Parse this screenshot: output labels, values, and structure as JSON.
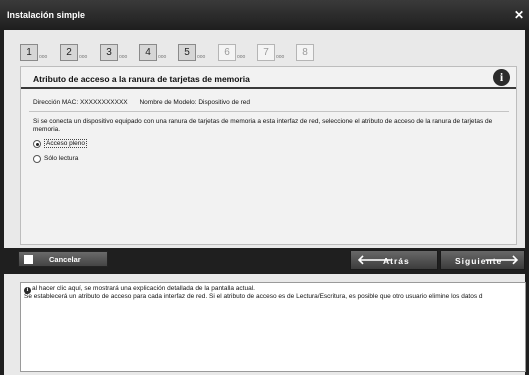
{
  "window": {
    "title": "Instalación simple",
    "close_icon": "close-icon"
  },
  "steps": [
    {
      "num": "1",
      "dots": "ooo",
      "state": "done"
    },
    {
      "num": "2",
      "dots": "ooo",
      "state": "done"
    },
    {
      "num": "3",
      "dots": "ooo",
      "state": "done"
    },
    {
      "num": "4",
      "dots": "ooo",
      "state": "done"
    },
    {
      "num": "5",
      "dots": "ooo",
      "state": "current"
    },
    {
      "num": "6",
      "dots": "ooo",
      "state": "future"
    },
    {
      "num": "7",
      "dots": "ooo",
      "state": "future"
    },
    {
      "num": "8",
      "dots": "",
      "state": "future"
    }
  ],
  "panel": {
    "title": "Atributo de acceso a la ranura de tarjetas de memoria",
    "info_icon": "info-icon",
    "mac_label": "Dirección MAC: XXXXXXXXXXX",
    "model_label": "Nombre de Modelo: Dispositivo de red",
    "description": "Si se conecta un dispositivo equipado con una ranura de tarjetas de memoria a esta interfaz de red, seleccione el atributo de acceso de la ranura de tarjetas de memoria.",
    "options": [
      {
        "label": "Acceso pleno",
        "selected": true
      },
      {
        "label": "Sólo lectura",
        "selected": false
      }
    ]
  },
  "buttons": {
    "cancel": "Cancelar",
    "back": "Atrás",
    "next": "Siguiente"
  },
  "help": {
    "line1": "al hacer clic aquí, se mostrará una explicación detallada de la pantalla actual.",
    "line2": "Se establecerá un atributo de acceso para cada interfaz de red. Si el atributo de acceso es de Lectura/Escritura, es posible que otro usuario elimine los datos d"
  }
}
